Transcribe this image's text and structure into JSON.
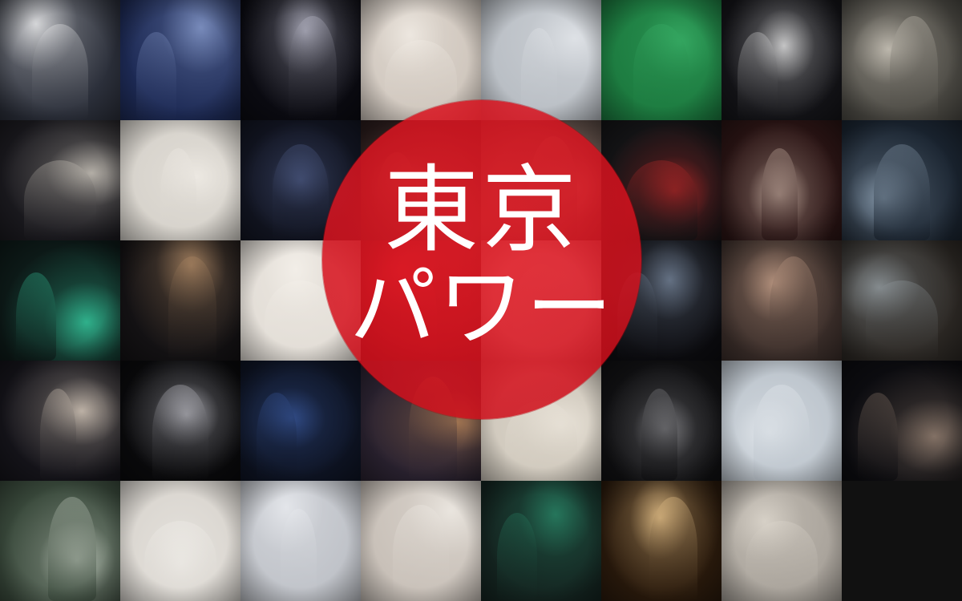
{
  "title": {
    "line1": "東京",
    "line2": "パワー"
  },
  "colors": {
    "disc": "#d9121e",
    "text": "#ffffff"
  },
  "tiles": [
    {
      "name": "photo-runway-audience-atrium",
      "tone": "#2b2f3a",
      "light": "#ffffff"
    },
    {
      "name": "photo-man-gray-hair-portrait",
      "tone": "#1d2a55",
      "light": "#8fa3d4"
    },
    {
      "name": "photo-dark-runway-screen",
      "tone": "#0b0b12",
      "light": "#c8c8d8"
    },
    {
      "name": "photo-woman-with-camera",
      "tone": "#cfc6bd",
      "light": "#f4efe8"
    },
    {
      "name": "photo-group-lineup-white-tent",
      "tone": "#b9bec4",
      "light": "#e7eaee"
    },
    {
      "name": "photo-model-green-backdrop",
      "tone": "#1c7a3f",
      "light": "#3bb36a"
    },
    {
      "name": "photo-runway-white-models",
      "tone": "#141418",
      "light": "#f0f0f0"
    },
    {
      "name": "photo-man-sweater-portrait",
      "tone": "#4c4a44",
      "light": "#d8d2c6"
    },
    {
      "name": "photo-model-long-dress-runway",
      "tone": "#1b1a1f",
      "light": "#d9d3c8"
    },
    {
      "name": "photo-backstage-lookboard",
      "tone": "#d6d2cb",
      "light": "#f2eee8"
    },
    {
      "name": "photo-wwd-magazine-cover",
      "tone": "#121522",
      "light": "#5a6a9a"
    },
    {
      "name": "photo-runway-black-look",
      "tone": "#2a1c1c",
      "light": "#8a6a5a"
    },
    {
      "name": "photo-man-knit-hat",
      "tone": "#5a4a44",
      "light": "#b89a88"
    },
    {
      "name": "photo-red-poster-backdrop",
      "tone": "#141416",
      "light": "#cf2a2a"
    },
    {
      "name": "photo-dark-stage-lights",
      "tone": "#2a1414",
      "light": "#e8d0c0"
    },
    {
      "name": "photo-runway-models-blue",
      "tone": "#1a2430",
      "light": "#9fb3c6"
    },
    {
      "name": "photo-shibuya-night-city",
      "tone": "#0d1a18",
      "light": "#38d6a8"
    },
    {
      "name": "photo-man-camel-coat",
      "tone": "#141214",
      "light": "#b8906a"
    },
    {
      "name": "photo-two-women-smiling",
      "tone": "#e2ddd6",
      "light": "#f6f2ec"
    },
    {
      "name": "photo-red-curtain",
      "tone": "#4a0c10",
      "light": "#c82c34"
    },
    {
      "name": "photo-women-holding-wwd",
      "tone": "#d4ccc4",
      "light": "#efe9e2"
    },
    {
      "name": "photo-runway-white-shirt",
      "tone": "#0c0c10",
      "light": "#7a8aa0"
    },
    {
      "name": "photo-young-man-portrait",
      "tone": "#3b2e2a",
      "light": "#cfa890"
    },
    {
      "name": "photo-model-gray-sweater",
      "tone": "#2c2824",
      "light": "#9aa3a8"
    },
    {
      "name": "photo-runway-finale-lineup",
      "tone": "#15141a",
      "light": "#e6d8c8"
    },
    {
      "name": "photo-stage-figures-lit",
      "tone": "#0a0a0c",
      "light": "#d8d8e0"
    },
    {
      "name": "photo-man-polka-dot-jacket",
      "tone": "#0e1424",
      "light": "#3a5aa0"
    },
    {
      "name": "photo-clothing-rack-colors",
      "tone": "#2a2230",
      "light": "#c08a5a"
    },
    {
      "name": "photo-backstage-wall-photos",
      "tone": "#cfc8bc",
      "light": "#f0eae0"
    },
    {
      "name": "photo-shaved-head-model",
      "tone": "#101012",
      "light": "#9a9a9e"
    },
    {
      "name": "photo-finale-white-tent",
      "tone": "#bcc4cc",
      "light": "#eef2f6"
    },
    {
      "name": "photo-group-night-street",
      "tone": "#0c0c10",
      "light": "#a08a7a"
    },
    {
      "name": "photo-tent-runway-green",
      "tone": "#3a4a3c",
      "light": "#dfe6da"
    },
    {
      "name": "photo-couple-mercedes-backdrop",
      "tone": "#dad6d0",
      "light": "#f6f4f0"
    },
    {
      "name": "photo-runway-dark-suits",
      "tone": "#bfc2c8",
      "light": "#eceef2"
    },
    {
      "name": "photo-champagne-glass",
      "tone": "#c8c0b8",
      "light": "#f2eee8"
    },
    {
      "name": "photo-runway-green-wall",
      "tone": "#142420",
      "light": "#2a8a6a"
    },
    {
      "name": "photo-grid-stage-lights",
      "tone": "#2a1a0c",
      "light": "#ffd89a"
    },
    {
      "name": "photo-woman-green-scarf",
      "tone": "#a8a29a",
      "light": "#e2dcd2"
    }
  ]
}
